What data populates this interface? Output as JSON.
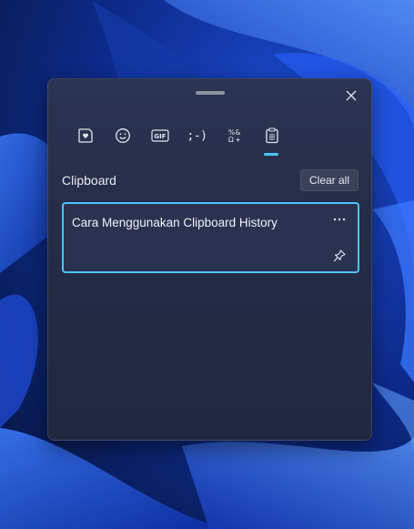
{
  "wallpaper": {
    "name": "windows-11-bloom-wallpaper"
  },
  "panel": {
    "close_icon": "close-icon",
    "tabs": [
      {
        "name": "tab-kaomoji-sticker",
        "icon": "heart-sticker-icon",
        "active": false
      },
      {
        "name": "tab-emoji",
        "icon": "emoji-icon",
        "active": false
      },
      {
        "name": "tab-gif",
        "icon": "gif-icon",
        "label": "GIF",
        "active": false
      },
      {
        "name": "tab-kaomoji",
        "icon": "kaomoji-icon",
        "label": ";-)",
        "active": false
      },
      {
        "name": "tab-symbols",
        "icon": "symbols-icon",
        "active": false
      },
      {
        "name": "tab-clipboard",
        "icon": "clipboard-icon",
        "active": true
      }
    ],
    "section_title": "Clipboard",
    "clear_all_label": "Clear all",
    "items": [
      {
        "text": "Cara Menggunakan Clipboard History",
        "more_icon": "more-icon",
        "pin_icon": "pin-icon"
      }
    ]
  },
  "colors": {
    "accent": "#4cc2ff",
    "panel_bg": "#252c47"
  }
}
